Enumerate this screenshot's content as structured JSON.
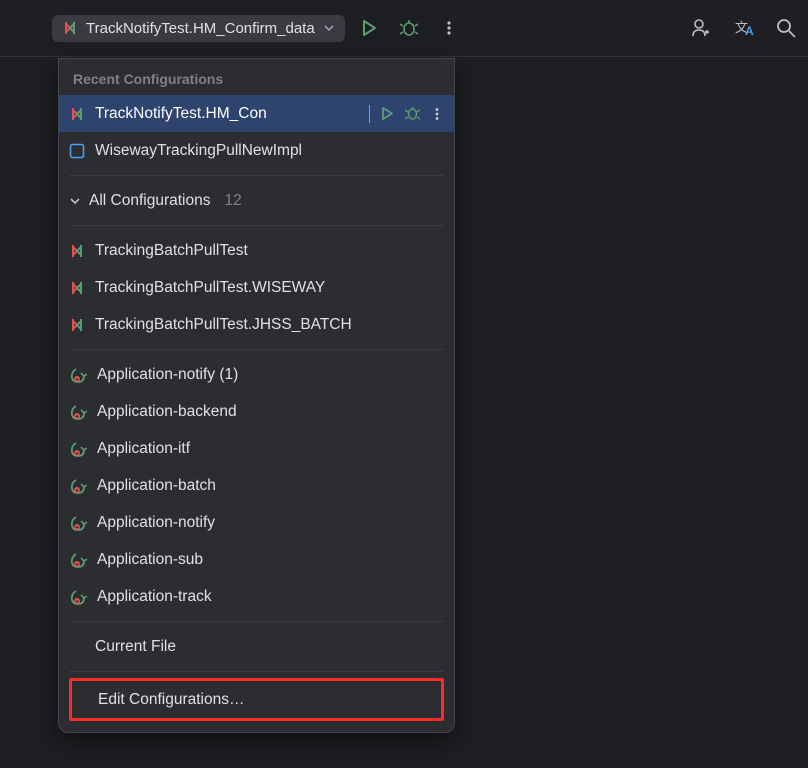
{
  "toolbar": {
    "selected_config": "TrackNotifyTest.HM_Confirm_data"
  },
  "dropdown": {
    "section_title": "Recent Configurations",
    "recent": [
      {
        "label": "TrackNotifyTest.HM_Con",
        "icon": "test",
        "selected": true
      },
      {
        "label": "WisewayTrackingPullNewImpl",
        "icon": "class",
        "selected": false
      }
    ],
    "all_header": "All Configurations",
    "all_count": "12",
    "tests": [
      {
        "label": "TrackingBatchPullTest"
      },
      {
        "label": "TrackingBatchPullTest.WISEWAY"
      },
      {
        "label": "TrackingBatchPullTest.JHSS_BATCH"
      }
    ],
    "apps": [
      {
        "label": "Application-notify (1)"
      },
      {
        "label": "Application-backend"
      },
      {
        "label": "Application-itf"
      },
      {
        "label": "Application-batch"
      },
      {
        "label": "Application-notify"
      },
      {
        "label": "Application-sub"
      },
      {
        "label": "Application-track"
      }
    ],
    "current_file": "Current File",
    "edit": "Edit Configurations…"
  }
}
